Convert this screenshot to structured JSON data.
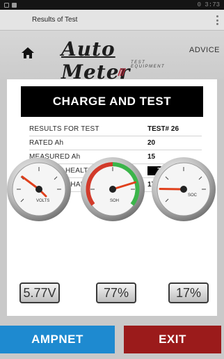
{
  "status_bar": {
    "right_text": "0  3:73"
  },
  "title_bar": {
    "title": "Results of Test"
  },
  "header": {
    "brand": "Auto Meter",
    "brand_sub": "TEST EQUIPMENT",
    "advice_label": "ADVICE"
  },
  "banner": {
    "text": "CHARGE AND TEST"
  },
  "results": [
    {
      "label": "RESULTS FOR TEST",
      "value": "TEST# 26"
    },
    {
      "label": "RATED Ah",
      "value": "20"
    },
    {
      "label": "MEASURED Ah",
      "value": "15"
    },
    {
      "label": "STATE OF HEALTH (SOH)",
      "value": "77%"
    },
    {
      "label": "STATE OF CHARGE (SOC)",
      "value": "17%"
    }
  ],
  "gauges": [
    {
      "name": "volts",
      "label": "VOLTS",
      "readout": "5.77V"
    },
    {
      "name": "soh",
      "label": "SOH",
      "readout": "77%",
      "level_percent": 77
    },
    {
      "name": "soc",
      "label": "SOC",
      "readout": "17%",
      "level_percent": 17
    }
  ],
  "buttons": {
    "ampnet": "AMPNET",
    "exit": "EXIT"
  },
  "colors": {
    "ampnet": "#1e8ad0",
    "exit": "#9b1b1b",
    "needle": "#e0401c",
    "soh_green": "#3bb54a",
    "soh_red": "#d23a2a"
  }
}
